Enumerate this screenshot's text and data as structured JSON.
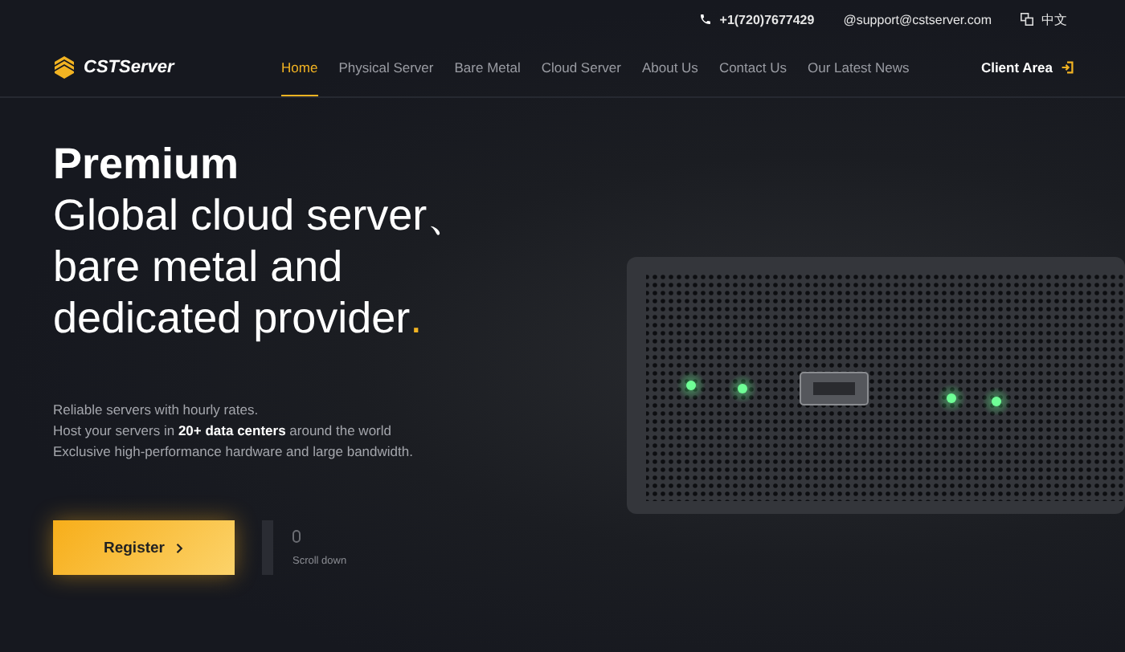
{
  "top_bar": {
    "phone": "+1(720)7677429",
    "email": "@support@cstserver.com",
    "language": "中文"
  },
  "brand": {
    "name": "CSTServer"
  },
  "nav": [
    {
      "label": "Home",
      "selected": true
    },
    {
      "label": "Physical Server",
      "selected": false
    },
    {
      "label": "Bare Metal",
      "selected": false
    },
    {
      "label": "Cloud Server",
      "selected": false
    },
    {
      "label": "About Us",
      "selected": false
    },
    {
      "label": "Contact Us",
      "selected": false
    },
    {
      "label": "Our Latest News",
      "selected": false
    }
  ],
  "client_area": "Client Area",
  "hero": {
    "lead": "Premium",
    "lines": [
      "Global cloud server、",
      "bare metal and",
      "dedicated provider"
    ],
    "end_mark": ".",
    "description": [
      "Reliable servers with hourly rates.",
      "Host your servers in **20+ data centers** around the world",
      "Exclusive high-performance hardware and large bandwidth."
    ],
    "register_button": "Register",
    "scroll_hint": "Scroll down"
  }
}
